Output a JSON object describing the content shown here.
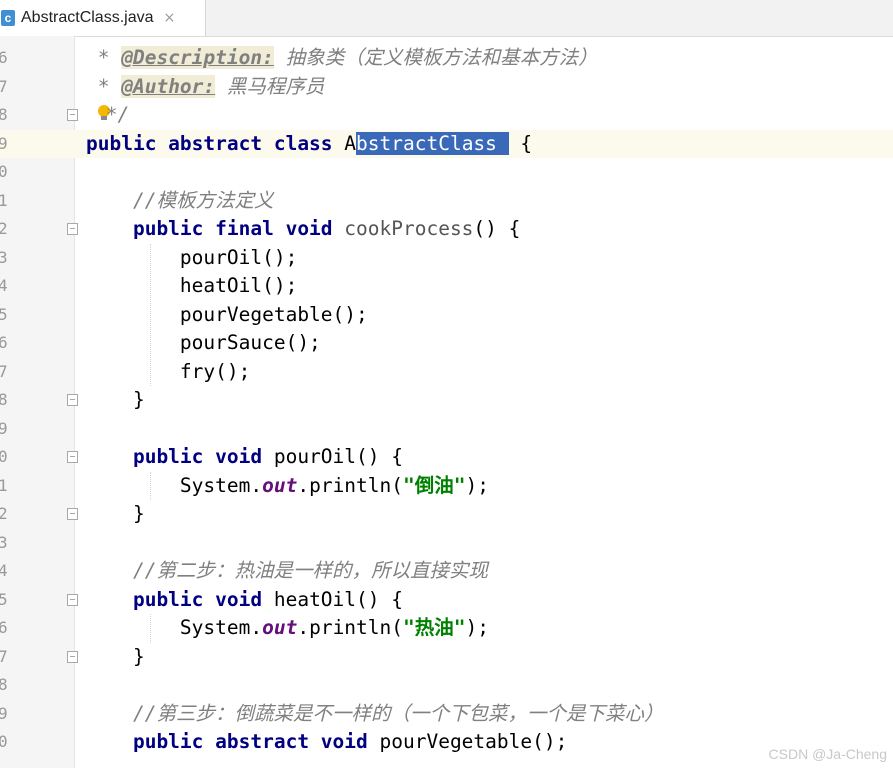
{
  "tab": {
    "icon_letter": "c",
    "title": "AbstractClass.java",
    "close": "×"
  },
  "lines": [
    {
      "num": "6",
      "parts": [
        [
          "cmt",
          " * "
        ],
        [
          "tag",
          "@Description:"
        ],
        [
          "cmt",
          " 抽象类（定义模板方法和基本方法）"
        ]
      ]
    },
    {
      "num": "7",
      "parts": [
        [
          "cmt",
          " * "
        ],
        [
          "tag",
          "@Author:"
        ],
        [
          "cmt",
          " 黑马程序员"
        ]
      ]
    },
    {
      "num": "8",
      "parts": [
        [
          "cmt",
          " */"
        ]
      ]
    },
    {
      "num": "9",
      "parts": [
        [
          "kw",
          "public abstract class "
        ],
        [
          "plain",
          "A"
        ],
        [
          "sel",
          "bstractClass "
        ],
        [
          "plain",
          " {"
        ]
      ]
    },
    {
      "num": "0",
      "parts": []
    },
    {
      "num": "1",
      "parts": [
        [
          "cmt",
          "    //模板方法定义"
        ]
      ]
    },
    {
      "num": "2",
      "parts": [
        [
          "kw",
          "    public final void "
        ],
        [
          "meth",
          "cookProcess"
        ],
        [
          "plain",
          "() {"
        ]
      ]
    },
    {
      "num": "3",
      "parts": [
        [
          "plain",
          "        pourOil();"
        ]
      ]
    },
    {
      "num": "4",
      "parts": [
        [
          "plain",
          "        heatOil();"
        ]
      ]
    },
    {
      "num": "5",
      "parts": [
        [
          "plain",
          "        pourVegetable();"
        ]
      ]
    },
    {
      "num": "6",
      "parts": [
        [
          "plain",
          "        pourSauce();"
        ]
      ]
    },
    {
      "num": "7",
      "parts": [
        [
          "plain",
          "        fry();"
        ]
      ]
    },
    {
      "num": "8",
      "parts": [
        [
          "plain",
          "    }"
        ]
      ]
    },
    {
      "num": "9",
      "parts": []
    },
    {
      "num": "0",
      "parts": [
        [
          "kw",
          "    public void "
        ],
        [
          "plain",
          "pourOil() {"
        ]
      ]
    },
    {
      "num": "1",
      "parts": [
        [
          "plain",
          "        System."
        ],
        [
          "fld",
          "out"
        ],
        [
          "plain",
          ".println("
        ],
        [
          "str",
          "\"倒油\""
        ],
        [
          "plain",
          ");"
        ]
      ]
    },
    {
      "num": "2",
      "parts": [
        [
          "plain",
          "    }"
        ]
      ]
    },
    {
      "num": "3",
      "parts": []
    },
    {
      "num": "4",
      "parts": [
        [
          "cmt",
          "    //第二步：热油是一样的，所以直接实现"
        ]
      ]
    },
    {
      "num": "5",
      "parts": [
        [
          "kw",
          "    public void "
        ],
        [
          "plain",
          "heatOil() {"
        ]
      ]
    },
    {
      "num": "6",
      "parts": [
        [
          "plain",
          "        System."
        ],
        [
          "fld",
          "out"
        ],
        [
          "plain",
          ".println("
        ],
        [
          "str",
          "\"热油\""
        ],
        [
          "plain",
          ");"
        ]
      ]
    },
    {
      "num": "7",
      "parts": [
        [
          "plain",
          "    }"
        ]
      ]
    },
    {
      "num": "8",
      "parts": []
    },
    {
      "num": "9",
      "parts": [
        [
          "cmt",
          "    //第三步：倒蔬菜是不一样的（一个下包菜，一个是下菜心）"
        ]
      ]
    },
    {
      "num": "0",
      "parts": [
        [
          "kw",
          "    public abstract void "
        ],
        [
          "plain",
          "pourVegetable();"
        ]
      ]
    }
  ],
  "watermark": "CSDN @Ja-Cheng"
}
